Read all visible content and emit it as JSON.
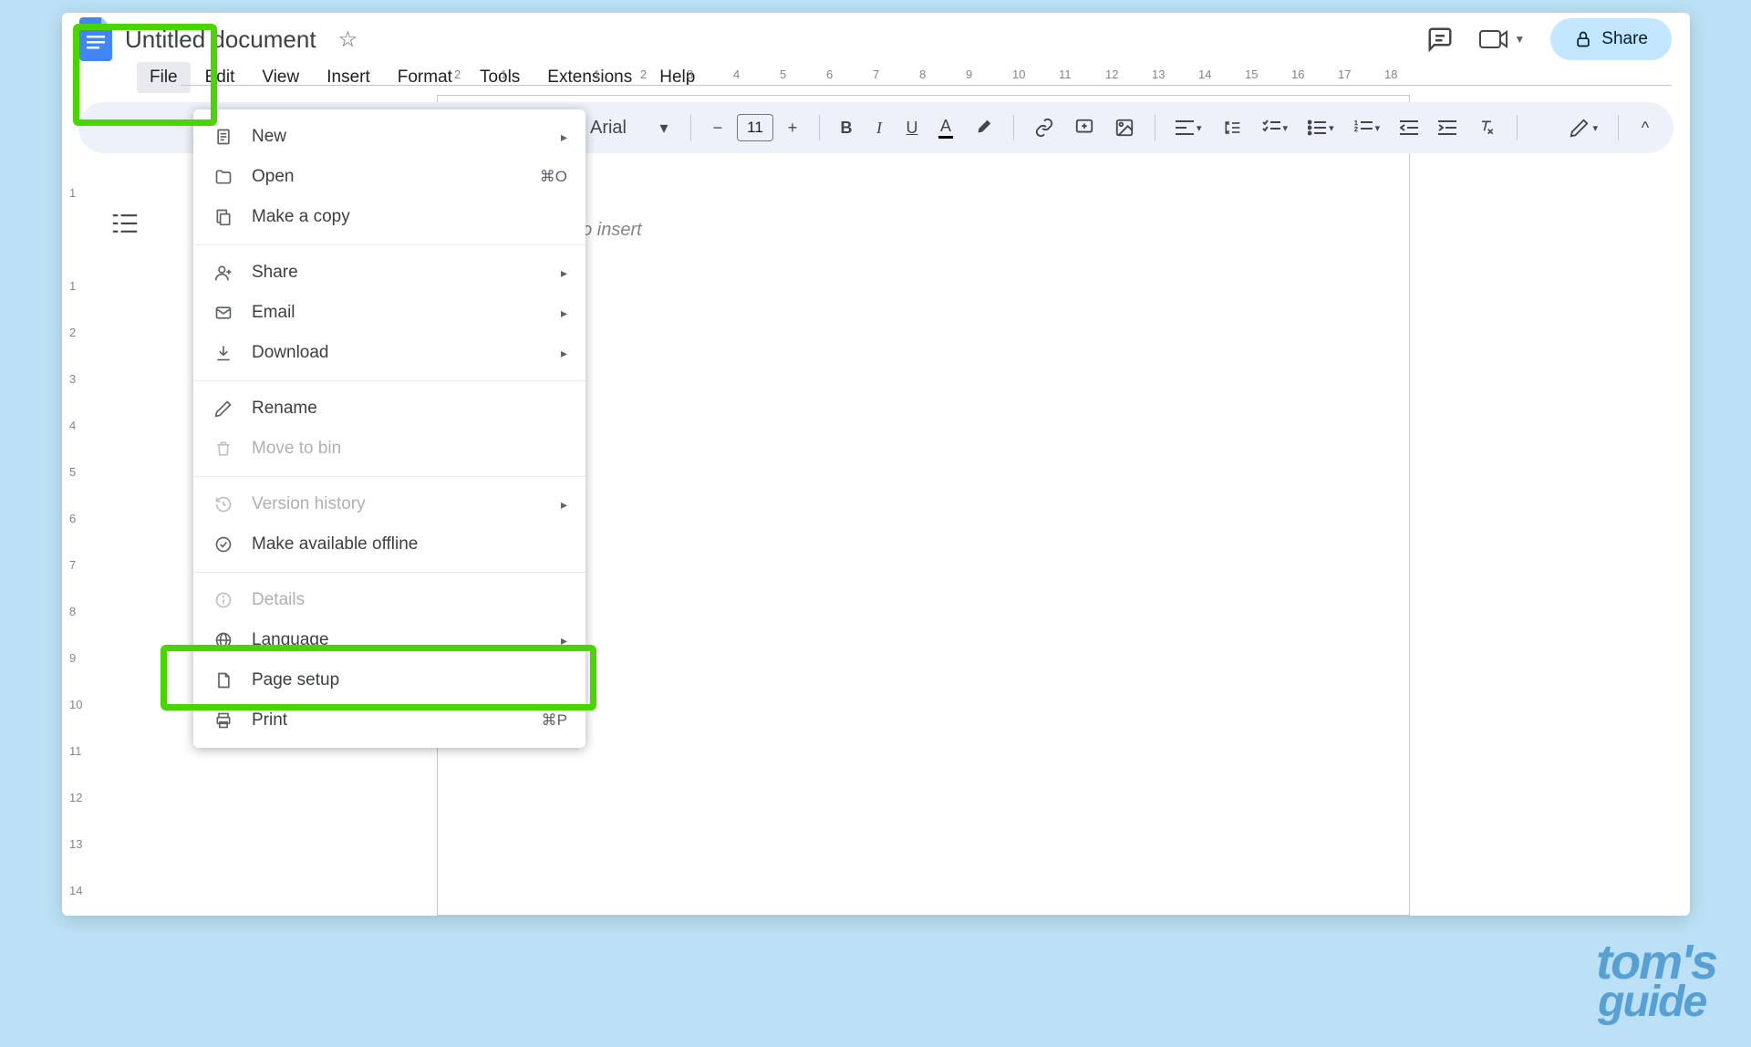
{
  "header": {
    "title": "Untitled document",
    "share_label": "Share"
  },
  "menubar": [
    "File",
    "Edit",
    "View",
    "Insert",
    "Format",
    "Tools",
    "Extensions",
    "Help"
  ],
  "toolbar": {
    "font_name": "Arial",
    "font_size": "11"
  },
  "file_menu": {
    "new": "New",
    "open": "Open",
    "open_shortcut": "⌘O",
    "make_copy": "Make a copy",
    "share": "Share",
    "email": "Email",
    "download": "Download",
    "rename": "Rename",
    "move_to_bin": "Move to bin",
    "version_history": "Version history",
    "available_offline": "Make available offline",
    "details": "Details",
    "language": "Language",
    "page_setup": "Page setup",
    "print": "Print",
    "print_shortcut": "⌘P"
  },
  "ruler_h": [
    "2",
    "1",
    "",
    "1",
    "2",
    "3",
    "4",
    "5",
    "6",
    "7",
    "8",
    "9",
    "10",
    "11",
    "12",
    "13",
    "14",
    "15",
    "16",
    "17",
    "18"
  ],
  "ruler_v": [
    "1",
    "",
    "1",
    "2",
    "3",
    "4",
    "5",
    "6",
    "7",
    "8",
    "9",
    "10",
    "11",
    "12",
    "13",
    "14"
  ],
  "canvas": {
    "placeholder_visible": "e @ to insert"
  },
  "watermark": {
    "line1": "tom's",
    "line2": "guide"
  }
}
